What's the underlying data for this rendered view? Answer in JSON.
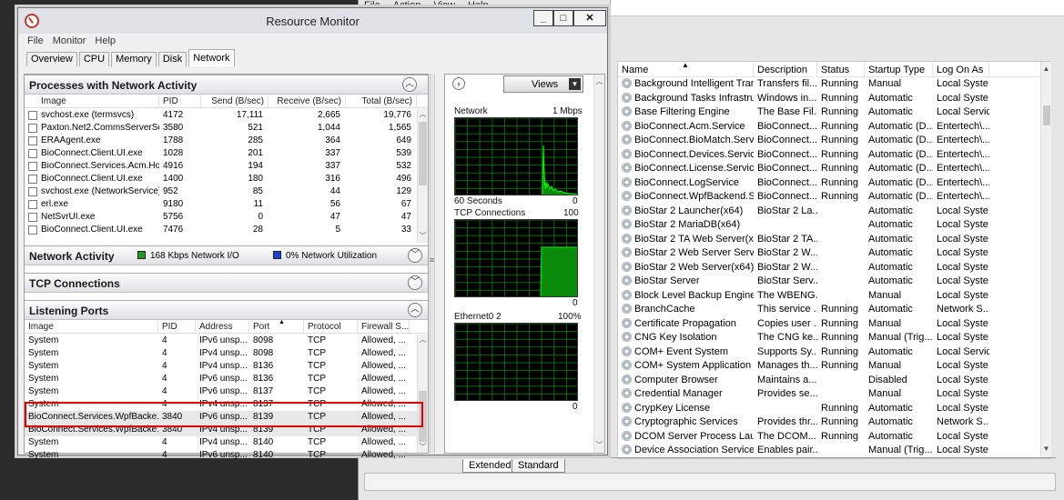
{
  "services_window": {
    "menu": [
      "File",
      "Action",
      "View",
      "Help"
    ],
    "columns": [
      "Name",
      "Description",
      "Status",
      "Startup Type",
      "Log On As"
    ],
    "rows": [
      [
        "Background Intelligent Tran...",
        "Transfers fil...",
        "Running",
        "Manual",
        "Local Syste..."
      ],
      [
        "Background Tasks Infrastru...",
        "Windows in...",
        "Running",
        "Automatic",
        "Local Syste..."
      ],
      [
        "Base Filtering Engine",
        "The Base Fil...",
        "Running",
        "Automatic",
        "Local Service"
      ],
      [
        "BioConnect.Acm.Service",
        "BioConnect...",
        "Running",
        "Automatic (D...",
        "Entertech\\..."
      ],
      [
        "BioConnect.BioMatch.Service",
        "BioConnect...",
        "Running",
        "Automatic (D...",
        "Entertech\\..."
      ],
      [
        "BioConnect.Devices.Service",
        "BioConnect...",
        "Running",
        "Automatic (D...",
        "Entertech\\..."
      ],
      [
        "BioConnect.License.Service",
        "BioConnect...",
        "Running",
        "Automatic (D...",
        "Entertech\\..."
      ],
      [
        "BioConnect.LogService",
        "BioConnect...",
        "Running",
        "Automatic (D...",
        "Entertech\\..."
      ],
      [
        "BioConnect.WpfBackend.Se...",
        "BioConnect...",
        "Running",
        "Automatic (D...",
        "Entertech\\..."
      ],
      [
        "BioStar 2 Launcher(x64)",
        "BioStar 2 La...",
        "",
        "Automatic",
        "Local Syste..."
      ],
      [
        "BioStar 2 MariaDB(x64)",
        "",
        "",
        "Automatic",
        "Local Syste..."
      ],
      [
        "BioStar 2 TA Web Server(x64)",
        "BioStar 2 TA...",
        "",
        "Automatic",
        "Local Syste..."
      ],
      [
        "BioStar 2 Web Server Service",
        "BioStar 2 W...",
        "",
        "Automatic",
        "Local Syste..."
      ],
      [
        "BioStar 2 Web Server(x64)",
        "BioStar 2 W...",
        "",
        "Automatic",
        "Local Syste..."
      ],
      [
        "BioStar Server",
        "BioStar Serv...",
        "",
        "Automatic",
        "Local Syste..."
      ],
      [
        "Block Level Backup Engine ...",
        "The WBENG...",
        "",
        "Manual",
        "Local Syste..."
      ],
      [
        "BranchCache",
        "This service ...",
        "Running",
        "Automatic",
        "Network S..."
      ],
      [
        "Certificate Propagation",
        "Copies user ...",
        "Running",
        "Manual",
        "Local Syste..."
      ],
      [
        "CNG Key Isolation",
        "The CNG ke...",
        "Running",
        "Manual (Trig...",
        "Local Syste..."
      ],
      [
        "COM+ Event System",
        "Supports Sy...",
        "Running",
        "Automatic",
        "Local Service"
      ],
      [
        "COM+ System Application",
        "Manages th...",
        "Running",
        "Manual",
        "Local Syste..."
      ],
      [
        "Computer Browser",
        "Maintains a...",
        "",
        "Disabled",
        "Local Syste..."
      ],
      [
        "Credential Manager",
        "Provides se...",
        "",
        "Manual",
        "Local Syste..."
      ],
      [
        "CrypKey License",
        "",
        "Running",
        "Automatic",
        "Local Syste..."
      ],
      [
        "Cryptographic Services",
        "Provides thr...",
        "Running",
        "Automatic",
        "Network S..."
      ],
      [
        "DCOM Server Process Laun...",
        "The DCOM...",
        "Running",
        "Automatic",
        "Local Syste..."
      ],
      [
        "Device Association Service",
        "Enables pair...",
        "",
        "Manual (Trig...",
        "Local Syste..."
      ]
    ],
    "bottom_tabs": [
      "Extended",
      "Standard"
    ]
  },
  "resource_monitor": {
    "title": "Resource Monitor",
    "menu": [
      "File",
      "Monitor",
      "Help"
    ],
    "tabs": [
      "Overview",
      "CPU",
      "Memory",
      "Disk",
      "Network"
    ],
    "active_tab": "Network",
    "processes": {
      "title": "Processes with Network Activity",
      "columns": [
        "Image",
        "PID",
        "Send (B/sec)",
        "Receive (B/sec)",
        "Total (B/sec)"
      ],
      "rows": [
        [
          "svchost.exe (termsvcs)",
          "4172",
          "17,111",
          "2,665",
          "19,776"
        ],
        [
          "Paxton.Net2.CommsServerSe...",
          "3580",
          "521",
          "1,044",
          "1,565"
        ],
        [
          "ERAAgent.exe",
          "1788",
          "285",
          "364",
          "649"
        ],
        [
          "BioConnect.Client.UI.exe",
          "1028",
          "201",
          "337",
          "539"
        ],
        [
          "BioConnect.Services.Acm.Ho...",
          "4916",
          "194",
          "337",
          "532"
        ],
        [
          "BioConnect.Client.UI.exe",
          "1400",
          "180",
          "316",
          "496"
        ],
        [
          "svchost.exe (NetworkService)",
          "952",
          "85",
          "44",
          "129"
        ],
        [
          "erl.exe",
          "9180",
          "11",
          "56",
          "67"
        ],
        [
          "NetSvrUI.exe",
          "5756",
          "0",
          "47",
          "47"
        ],
        [
          "BioConnect.Client.UI.exe",
          "7476",
          "28",
          "5",
          "33"
        ]
      ]
    },
    "network_activity": {
      "title": "Network Activity",
      "io_label": "168 Kbps Network I/O",
      "util_label": "0% Network Utilization",
      "io_color": "#1f9a1f",
      "util_color": "#1d3fd6"
    },
    "tcp_connections": {
      "title": "TCP Connections"
    },
    "listening_ports": {
      "title": "Listening Ports",
      "columns": [
        "Image",
        "PID",
        "Address",
        "Port",
        "Protocol",
        "Firewall S..."
      ],
      "rows": [
        [
          "System",
          "4",
          "IPv6 unsp...",
          "8098",
          "TCP",
          "Allowed, ..."
        ],
        [
          "System",
          "4",
          "IPv4 unsp...",
          "8098",
          "TCP",
          "Allowed, ..."
        ],
        [
          "System",
          "4",
          "IPv4 unsp...",
          "8136",
          "TCP",
          "Allowed, ..."
        ],
        [
          "System",
          "4",
          "IPv6 unsp...",
          "8136",
          "TCP",
          "Allowed, ..."
        ],
        [
          "System",
          "4",
          "IPv6 unsp...",
          "8137",
          "TCP",
          "Allowed, ..."
        ],
        [
          "System",
          "4",
          "IPv4 unsp...",
          "8137",
          "TCP",
          "Allowed, ..."
        ],
        [
          "BioConnect.Services.WpfBacke...",
          "3840",
          "IPv6 unsp...",
          "8139",
          "TCP",
          "Allowed, ..."
        ],
        [
          "BioConnect.Services.WpfBacke...",
          "3840",
          "IPv4 unsp...",
          "8139",
          "TCP",
          "Allowed, ..."
        ],
        [
          "System",
          "4",
          "IPv4 unsp...",
          "8140",
          "TCP",
          "Allowed, ..."
        ],
        [
          "System",
          "4",
          "IPv6 unsp...",
          "8140",
          "TCP",
          "Allowed, ..."
        ]
      ]
    },
    "views_label": "Views",
    "graphs": {
      "network": {
        "label": "Network",
        "max": "1 Mbps",
        "time": "60 Seconds",
        "min": "0"
      },
      "tcp": {
        "label": "TCP Connections",
        "max": "100",
        "min": "0"
      },
      "ethernet": {
        "label": "Ethernet0 2",
        "max": "100%",
        "min": "0"
      }
    },
    "graph_colors": {
      "line": "#00ff00",
      "fill": "#0a8a0a",
      "grid": "#0b6b0b"
    }
  }
}
